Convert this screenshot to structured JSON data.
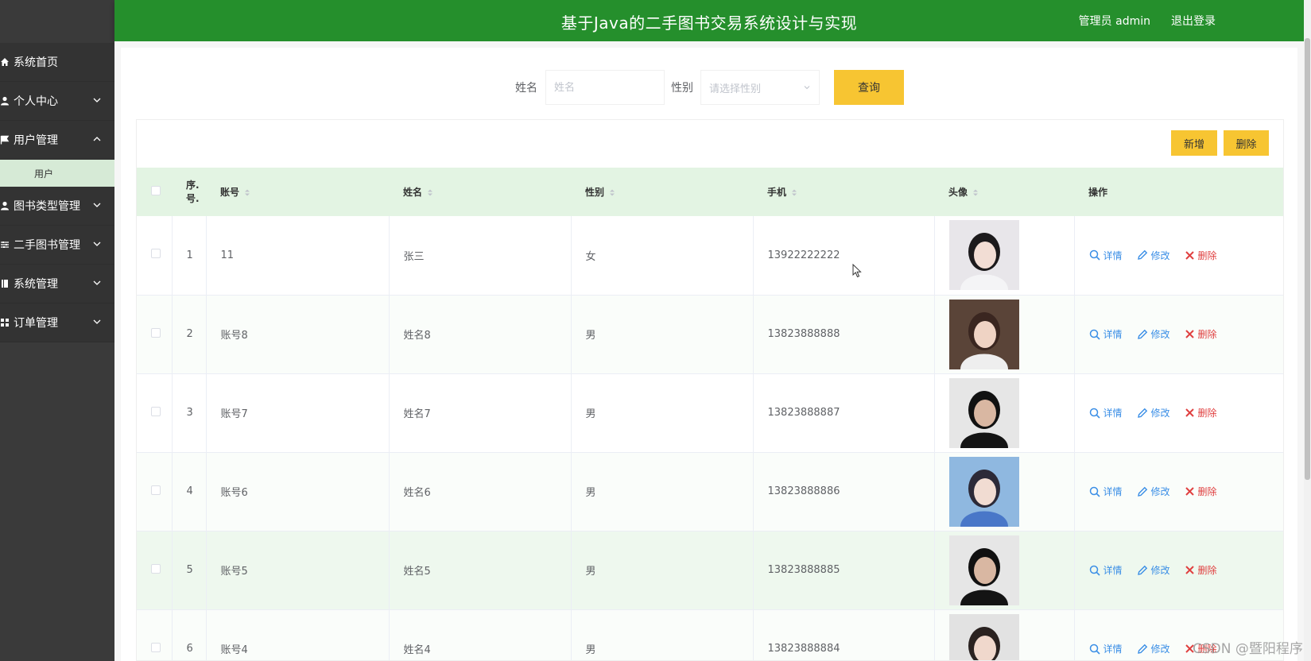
{
  "header": {
    "title": "基于Java的二手图书交易系统设计与实现",
    "user_label": "管理员",
    "username": "admin",
    "logout": "退出登录",
    "color": "#258f2c"
  },
  "sidebar": {
    "items": [
      {
        "label": "系统首页",
        "icon": "home-icon",
        "arrow": ""
      },
      {
        "label": "个人中心",
        "icon": "user-icon",
        "arrow": "down"
      },
      {
        "label": "用户管理",
        "icon": "flag-icon",
        "arrow": "up"
      },
      {
        "label": "图书类型管理",
        "icon": "user-icon",
        "arrow": "down"
      },
      {
        "label": "二手图书管理",
        "icon": "sliders-icon",
        "arrow": "down"
      },
      {
        "label": "系统管理",
        "icon": "book-icon",
        "arrow": "down"
      },
      {
        "label": "订单管理",
        "icon": "grid-icon",
        "arrow": "down"
      }
    ],
    "sub_item": "用户"
  },
  "search": {
    "name_label": "姓名",
    "name_placeholder": "姓名",
    "gender_label": "性别",
    "gender_placeholder": "请选择性别",
    "query_button": "查询"
  },
  "toolbar": {
    "add": "新增",
    "delete": "删除",
    "accent": "#f7c532"
  },
  "table": {
    "columns": [
      "序号",
      "账号",
      "姓名",
      "性别",
      "手机",
      "头像",
      "操作"
    ],
    "index_header_line1": "序.",
    "index_header_line2": "号.",
    "rows": [
      {
        "idx": "1",
        "account": "11",
        "name": "张三",
        "gender": "女",
        "phone": "13922222222"
      },
      {
        "idx": "2",
        "account": "账号8",
        "name": "姓名8",
        "gender": "男",
        "phone": "13823888888"
      },
      {
        "idx": "3",
        "account": "账号7",
        "name": "姓名7",
        "gender": "男",
        "phone": "13823888887"
      },
      {
        "idx": "4",
        "account": "账号6",
        "name": "姓名6",
        "gender": "男",
        "phone": "13823888886"
      },
      {
        "idx": "5",
        "account": "账号5",
        "name": "姓名5",
        "gender": "男",
        "phone": "13823888885"
      },
      {
        "idx": "6",
        "account": "账号4",
        "name": "姓名4",
        "gender": "男",
        "phone": "13823888884"
      }
    ],
    "ops": {
      "detail": "详情",
      "edit": "修改",
      "delete": "删除"
    }
  },
  "watermark": "CSDN @暨阳程序"
}
